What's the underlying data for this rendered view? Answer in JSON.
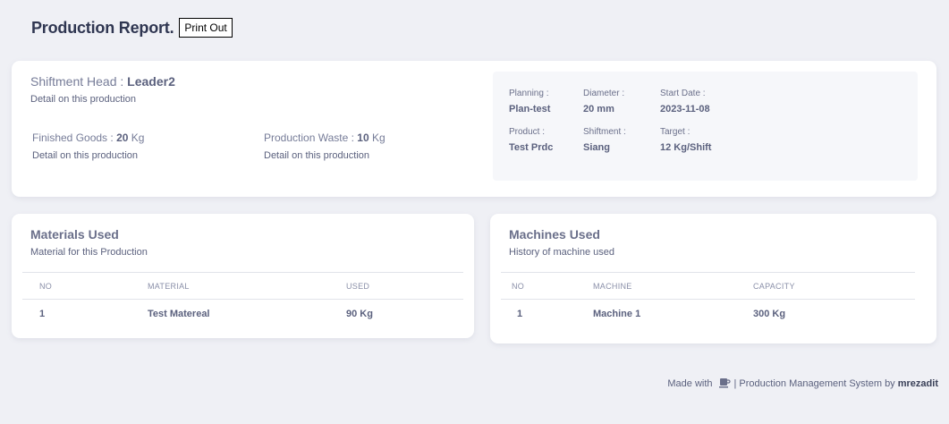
{
  "header": {
    "title": "Production Report.",
    "print_label": "Print Out"
  },
  "summary": {
    "head_label": "Shiftment Head : ",
    "head_value": "Leader2",
    "head_desc": "Detail on this production",
    "finished": {
      "label": "Finished Goods : ",
      "value": "20",
      "unit": " Kg",
      "desc": "Detail on this production"
    },
    "waste": {
      "label": "Production Waste : ",
      "value": "10",
      "unit": " Kg",
      "desc": "Detail on this production"
    },
    "info": {
      "planning": {
        "label": "Planning :",
        "value": "Plan-test"
      },
      "diameter": {
        "label": "Diameter :",
        "value": "20 mm"
      },
      "start_date": {
        "label": "Start Date :",
        "value": "2023-11-08"
      },
      "product": {
        "label": "Product :",
        "value": "Test Prdc"
      },
      "shiftment": {
        "label": "Shiftment :",
        "value": "Siang"
      },
      "target": {
        "label": "Target :",
        "value": "12 Kg/Shift"
      }
    }
  },
  "materials": {
    "title": "Materials Used",
    "subtitle": "Material for this Production",
    "columns": [
      "NO",
      "MATERIAL",
      "USED"
    ],
    "rows": [
      [
        "1",
        "Test Matereal",
        "90 Kg"
      ]
    ]
  },
  "machines": {
    "title": "Machines Used",
    "subtitle": "History of machine used",
    "columns": [
      "NO",
      "MACHINE",
      "CAPACITY"
    ],
    "rows": [
      [
        "1",
        "Machine 1",
        "300 Kg"
      ]
    ]
  },
  "footer": {
    "made_with": "Made with",
    "icon": "coffee-icon",
    "text": "| Production Management System by",
    "author": "mrezadit"
  }
}
